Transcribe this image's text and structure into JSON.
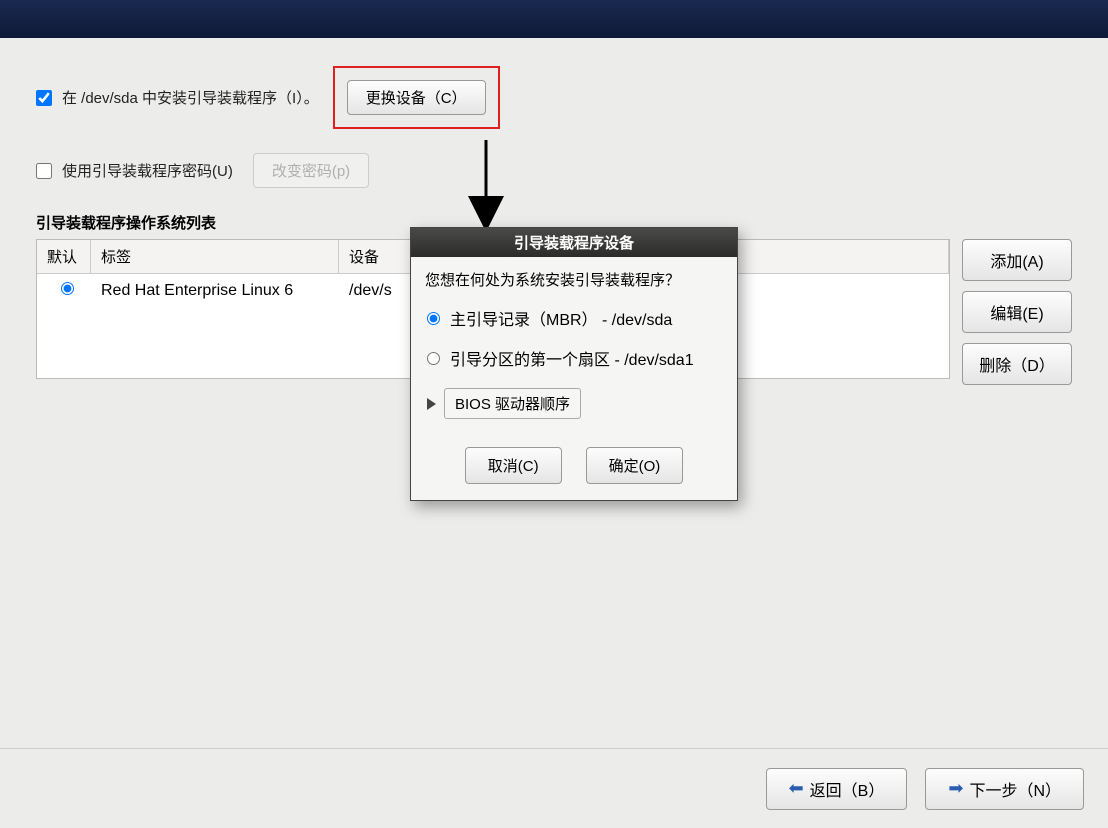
{
  "checkbox1": {
    "label": "在 /dev/sda 中安装引导装载程序（I）。",
    "checked": true
  },
  "change_device_btn": "更换设备（C）",
  "checkbox2": {
    "label": "使用引导装载程序密码(U)",
    "checked": false
  },
  "change_pw_btn": "改变密码(p)",
  "table_title": "引导装载程序操作系统列表",
  "table": {
    "col_default": "默认",
    "col_label": "标签",
    "col_device": "设备",
    "rows": [
      {
        "label": "Red Hat Enterprise Linux 6",
        "device": "/dev/s"
      }
    ]
  },
  "side": {
    "add": "添加(A)",
    "edit": "编辑(E)",
    "delete": "删除（D）"
  },
  "dialog": {
    "title": "引导装载程序设备",
    "prompt": "您想在何处为系统安装引导装载程序？",
    "opt1": "主引导记录（MBR） - /dev/sda",
    "opt2": "引导分区的第一个扇区 - /dev/sda1",
    "bios_btn": "BIOS 驱动器顺序",
    "cancel": "取消(C)",
    "ok": "确定(O)"
  },
  "footer": {
    "back": "返回（B）",
    "next": "下一步（N）"
  }
}
